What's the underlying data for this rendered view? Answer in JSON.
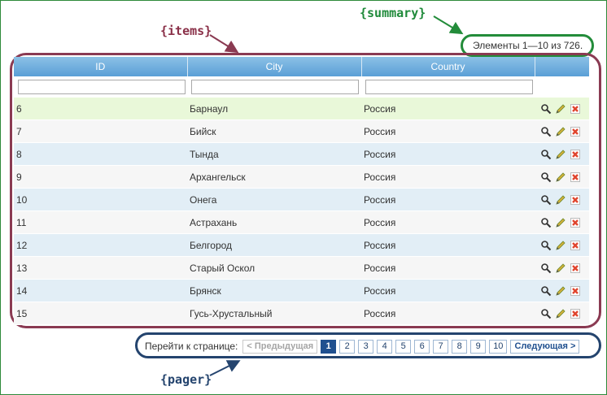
{
  "annotations": {
    "summary_tag": "{summary}",
    "items_tag": "{items}",
    "pager_tag": "{pager}"
  },
  "summary": {
    "text": "Элементы 1—10 из 726."
  },
  "columns": [
    "ID",
    "City",
    "Country"
  ],
  "rows": [
    {
      "id": "6",
      "city": "Барнаул",
      "country": "Россия"
    },
    {
      "id": "7",
      "city": "Бийск",
      "country": "Россия"
    },
    {
      "id": "8",
      "city": "Тында",
      "country": "Россия"
    },
    {
      "id": "9",
      "city": "Архангельск",
      "country": "Россия"
    },
    {
      "id": "10",
      "city": "Онега",
      "country": "Россия"
    },
    {
      "id": "11",
      "city": "Астрахань",
      "country": "Россия"
    },
    {
      "id": "12",
      "city": "Белгород",
      "country": "Россия"
    },
    {
      "id": "13",
      "city": "Старый Оскол",
      "country": "Россия"
    },
    {
      "id": "14",
      "city": "Брянск",
      "country": "Россия"
    },
    {
      "id": "15",
      "city": "Гусь-Хрустальный",
      "country": "Россия"
    }
  ],
  "row_actions": [
    "view-icon",
    "edit-icon",
    "delete-icon"
  ],
  "pager": {
    "label": "Перейти к странице:",
    "prev": "< Предыдущая",
    "next": "Следующая >",
    "pages": [
      "1",
      "2",
      "3",
      "4",
      "5",
      "6",
      "7",
      "8",
      "9",
      "10"
    ],
    "current_page": "1"
  },
  "colors": {
    "summary": "#238c3a",
    "items": "#8a3a52",
    "pager": "#24446e",
    "header": "#5a9fd6",
    "selected_row": "#e9f8d9"
  }
}
